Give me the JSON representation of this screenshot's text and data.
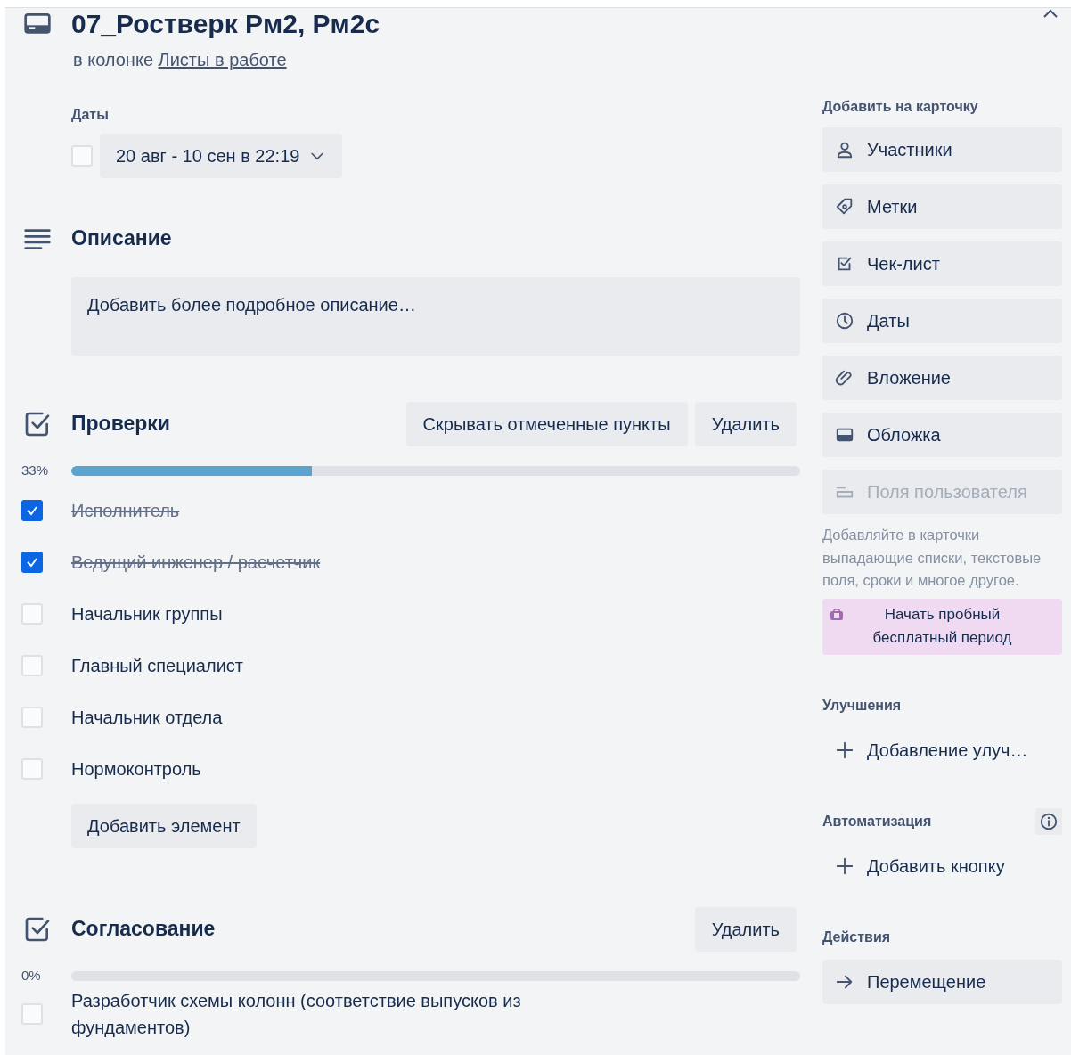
{
  "card": {
    "title": "07_Ростверк Рм2, Рм2с",
    "column_prefix": "в колонке",
    "column_link": "Листы в работе"
  },
  "dates": {
    "label": "Даты",
    "value": "20 авг - 10 сен в 22:19",
    "checked": false
  },
  "description": {
    "title": "Описание",
    "placeholder": "Добавить более подробное описание…"
  },
  "checklists": [
    {
      "title": "Проверки",
      "buttons": [
        "Скрывать отмеченные пункты",
        "Удалить"
      ],
      "percent": "33%",
      "level": 0.33,
      "items": [
        {
          "text": "Исполнитель",
          "checked": true
        },
        {
          "text": "Ведущий инженер / расчетчик",
          "checked": true
        },
        {
          "text": "Начальник группы",
          "checked": false
        },
        {
          "text": "Главный специалист",
          "checked": false
        },
        {
          "text": "Начальник отдела",
          "checked": false
        },
        {
          "text": "Нормоконтроль",
          "checked": false
        }
      ],
      "add_button": "Добавить элемент"
    },
    {
      "title": "Согласование",
      "buttons": [
        "Удалить"
      ],
      "percent": "0%",
      "level": 0,
      "items": [
        {
          "text": "Разработчик схемы колонн (соответствие выпусков из фундаментов)",
          "checked": false
        }
      ]
    }
  ],
  "sidebar": {
    "add_title": "Добавить на карточку",
    "add_items": [
      {
        "label": "Участники",
        "disabled": false
      },
      {
        "label": "Метки",
        "disabled": false
      },
      {
        "label": "Чек-лист",
        "disabled": false
      },
      {
        "label": "Даты",
        "disabled": false
      },
      {
        "label": "Вложение",
        "disabled": false
      },
      {
        "label": "Обложка",
        "disabled": false
      },
      {
        "label": "Поля пользователя",
        "disabled": true
      }
    ],
    "hint": "Добавляйте в карточки выпадающие списки, текстовые поля, сроки и многое другое.",
    "trial_button": "Начать пробный бесплатный период",
    "sections": [
      {
        "title": "Улучшения",
        "info": false,
        "actions": [
          {
            "kind": "add",
            "label": "Добавление улуч…"
          }
        ]
      },
      {
        "title": "Автоматизация",
        "info": true,
        "actions": [
          {
            "kind": "add",
            "label": "Добавить кнопку"
          }
        ]
      },
      {
        "title": "Действия",
        "info": false,
        "actions": [
          {
            "kind": "move",
            "label": "Перемещение"
          }
        ]
      }
    ]
  }
}
